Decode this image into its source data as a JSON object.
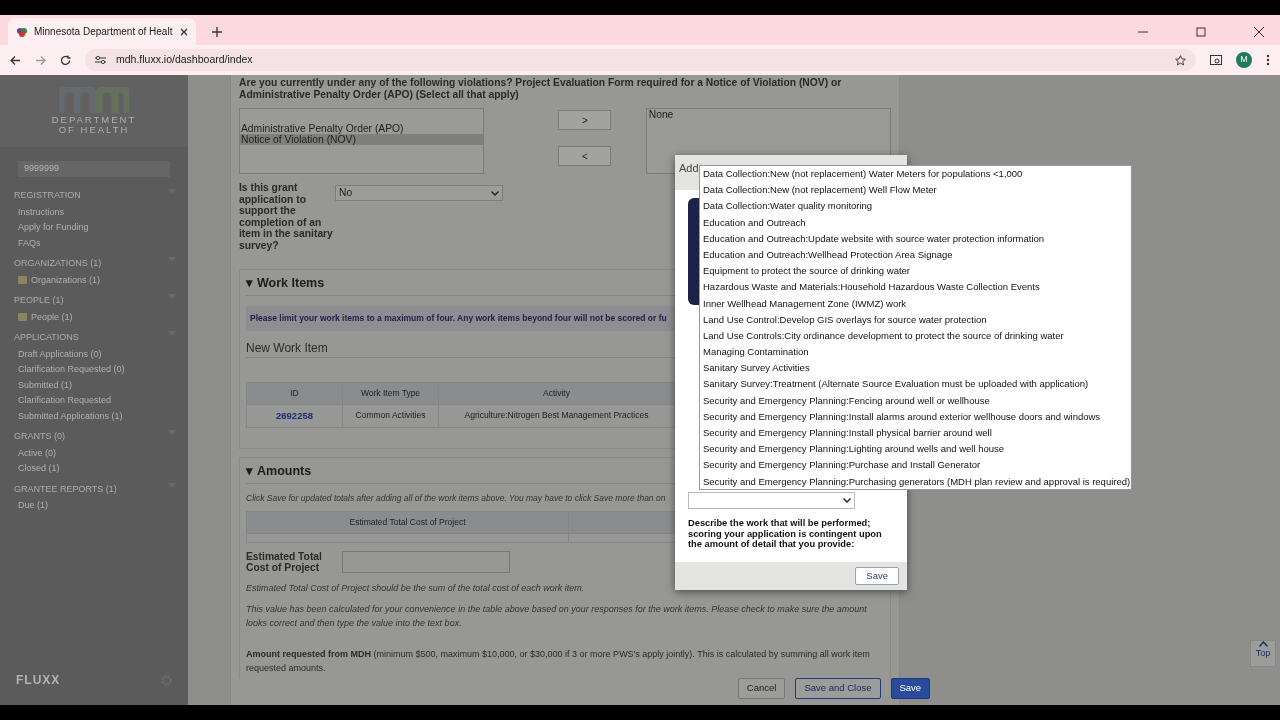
{
  "browser": {
    "tab_title": "Minnesota Department of Healt",
    "url": "mdh.fluxx.io/dashboard/index",
    "profile": "M"
  },
  "sidebar": {
    "logo_lines": [
      "DEPARTMENT",
      "OF HEALTH"
    ],
    "search_value": "9999999",
    "footer_logo": "FLUXX",
    "sections": [
      {
        "title": "REGISTRATION",
        "items": [
          "Instructions",
          "Apply for Funding",
          "FAQs"
        ]
      },
      {
        "title": "ORGANIZATIONS (1)",
        "items": [
          "Organizations (1)"
        ],
        "with_icon": true
      },
      {
        "title": "PEOPLE (1)",
        "items": [
          "People (1)"
        ],
        "with_icon": true
      },
      {
        "title": "APPLICATIONS",
        "items": [
          "Draft Applications (0)",
          "Clarification Requested (0)",
          "Submitted (1)",
          "Clarification Requested",
          "Submitted Applications (1)"
        ]
      },
      {
        "title": "GRANTS (0)",
        "items": [
          "Active (0)",
          "Closed (1)"
        ]
      },
      {
        "title": "GRANTEE REPORTS (1)",
        "items": [
          "Due (1)"
        ]
      }
    ]
  },
  "violations": {
    "question": "Are you currently under any of the following violations? Project Evaluation Form required for a Notice of Violation (NOV) or Administrative Penalty Order (APO) (Select all that apply)",
    "options": [
      {
        "label": "Administrative Penalty Order (APO)",
        "selected": false
      },
      {
        "label": "Notice of Violation (NOV)",
        "selected": true
      }
    ],
    "move_buttons": [
      ">",
      "<"
    ],
    "chosen": [
      "None"
    ]
  },
  "grant_question": {
    "label": "Is this grant application to support the completion of an item in the sanitary survey?",
    "value": "No"
  },
  "work_items": {
    "toggle": "▾",
    "heading": "Work Items",
    "expanded": true,
    "alert": "Please limit your work items to a maximum of four. Any work items beyond four will not be scored or fu",
    "subheading": "New Work Item",
    "table": {
      "columns": [
        "ID",
        "Work Item Type",
        "Activity"
      ],
      "rows": [
        [
          "2692258",
          "Common Activities",
          "Agriculture:Nitrogen Best Management Practices"
        ]
      ]
    }
  },
  "amounts": {
    "toggle": "▾",
    "heading": "Amounts",
    "expanded": true,
    "note": "Click Save for updated totals after adding all of the work items above. You may have to click Save more than on",
    "table": {
      "columns": [
        "Estimated Total Cost of Project"
      ]
    },
    "field_label": "Estimated Total Cost of Project",
    "notes": [
      "Estimated Total Cost of Project should be the sum of the total cost of each work item.",
      "This value has been calculated for your convenience in the table above based on your responses for the work items. Please check to make sure the amount looks correct and then type the value into the text box."
    ],
    "requested": "**Amount requested from MDH** (minimum $500, maximum $10,000, or $30,000 if 3 or more PWS's apply jointly). This is calculated by summing all work item requested amounts."
  },
  "modal": {
    "title": "Add",
    "description_label": "Describe the work that will be performed; scoring your application is contingent upon the amount of detail that you provide:",
    "save": "Save"
  },
  "dropdown_options": [
    "Data Collection:New (not replacement) Water Meters for populations <1,000",
    "Data Collection:New (not replacement) Well Flow Meter",
    "Data Collection:Water quality monitoring",
    "Education and Outreach",
    "Education and Outreach:Update website with source water protection information",
    "Education and Outreach:Wellhead Protection Area Signage",
    "Equipment to protect the source of drinking water",
    "Hazardous Waste and Materials:Household Hazardous Waste Collection Events",
    "Inner Wellhead Management Zone (IWMZ) work",
    "Land Use Control:Develop GIS overlays for source water protection",
    "Land Use Controls:City ordinance development to protect the source of drinking water",
    "Managing Contamination",
    "Sanitary Survey Activities",
    "Sanitary Survey:Treatment (Alternate Source Evaluation must be uploaded with application)",
    "Security and Emergency Planning:Fencing around well or wellhouse",
    "Security and Emergency Planning:Install alarms around exterior wellhouse doors and windows",
    "Security and Emergency Planning:Install physical barrier around well",
    "Security and Emergency Planning:Lighting around wells and well house",
    "Security and Emergency Planning:Purchase and Install Generator",
    "Security and Emergency Planning:Purchasing generators (MDH plan review and approval is required)"
  ],
  "footer_buttons": [
    {
      "label": "Cancel",
      "kind": "plain"
    },
    {
      "label": "Save and Close",
      "kind": "outline"
    },
    {
      "label": "Save",
      "kind": "primary"
    }
  ],
  "top_button": "Top"
}
